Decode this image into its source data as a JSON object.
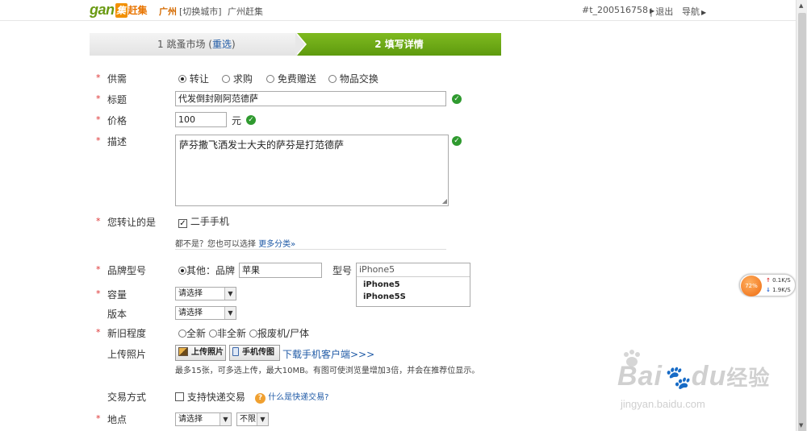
{
  "header": {
    "logo_gan": "gan",
    "logo_ji": "ji",
    "logo_cn": "赶集",
    "city": "广州",
    "switch_city": "[切换城市]",
    "city_site": "广州赶集",
    "user": "#t_200516758",
    "logout": "| 退出",
    "nav": "导航"
  },
  "steps": {
    "step1": "1 跳蚤市场 (",
    "step1_link": "重选",
    "step1_close": ")",
    "step2": "2 填写详情"
  },
  "form": {
    "supply": {
      "label": "供需",
      "options": [
        "转让",
        "求购",
        "免费赠送",
        "物品交换"
      ],
      "selected": "转让"
    },
    "title": {
      "label": "标题",
      "value": "代发倒封刚阿范德萨"
    },
    "price": {
      "label": "价格",
      "value": "100",
      "unit": "元"
    },
    "desc": {
      "label": "描述",
      "value": "萨芬撒飞洒发士大夫的萨芬是打范德萨"
    },
    "category": {
      "label": "您转让的是",
      "value": "二手手机",
      "checked": true,
      "hint_prefix": "都不是？您也可以选择",
      "hint_link": "更多分类»"
    },
    "brand": {
      "label": "品牌型号",
      "option": "其他：品牌",
      "brand_value": "苹果",
      "model_label": "型号",
      "model_value": "iPhone5",
      "suggestions": [
        "iPhone5",
        "iPhone5S"
      ]
    },
    "capacity": {
      "label": "容量",
      "value": "请选择"
    },
    "version": {
      "label": "版本",
      "value": "请选择"
    },
    "condition": {
      "label": "新旧程度",
      "options": [
        "全新",
        "非全新",
        "报废机/尸体"
      ]
    },
    "upload": {
      "label": "上传照片",
      "btn_photo": "上传照片",
      "btn_phone": "手机传图",
      "download_link": "下载手机客户端>>>",
      "note": "最多15张，可多选上传，最大10MB。有图可使浏览量增加3倍，并会在推荐位显示。"
    },
    "trade": {
      "label": "交易方式",
      "option": "支持快递交易",
      "help": "什么是快递交易?"
    },
    "location": {
      "label": "地点",
      "select1": "请选择",
      "select2": "不限"
    }
  },
  "speed_widget": {
    "percent": "72%",
    "up": "0.1K/S",
    "down": "1.9K/S"
  },
  "watermark": {
    "brand": "Bai",
    "brand2": "du",
    "cn": "经验",
    "url": "jingyan.baidu.com"
  },
  "colors": {
    "accent_green": "#6a9a12",
    "step_active": "#5e9a0e",
    "link": "#1f5aa6",
    "required": "#dd3333"
  }
}
